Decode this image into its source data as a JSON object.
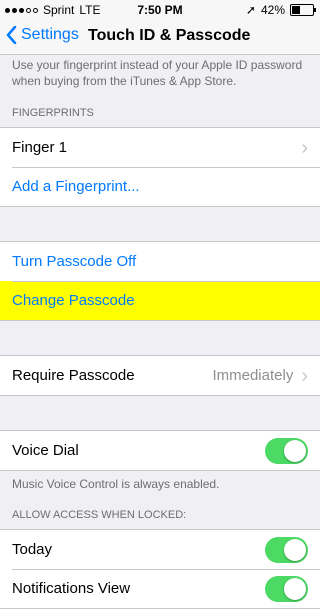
{
  "status_bar": {
    "carrier": "Sprint",
    "network": "LTE",
    "time": "7:50 PM",
    "battery_percent": "42%",
    "battery_level": 0.42,
    "signal_bars_filled": 3,
    "signal_bars_total": 5
  },
  "nav": {
    "back_label": "Settings",
    "title": "Touch ID & Passcode"
  },
  "description": "Use your fingerprint instead of your Apple ID password when buying from the iTunes & App Store.",
  "fingerprints": {
    "header": "FINGERPRINTS",
    "finger1": "Finger 1",
    "add": "Add a Fingerprint..."
  },
  "passcode": {
    "turn_off": "Turn Passcode Off",
    "change": "Change Passcode"
  },
  "require": {
    "label": "Require Passcode",
    "value": "Immediately"
  },
  "voice_dial": {
    "label": "Voice Dial",
    "enabled": true,
    "footer": "Music Voice Control is always enabled."
  },
  "locked": {
    "header": "ALLOW ACCESS WHEN LOCKED:",
    "today": "Today",
    "today_enabled": true,
    "notifications": "Notifications View",
    "notifications_enabled": true
  },
  "colors": {
    "accent": "#007aff",
    "toggle_on": "#4cd964",
    "highlight": "#ffff00"
  }
}
